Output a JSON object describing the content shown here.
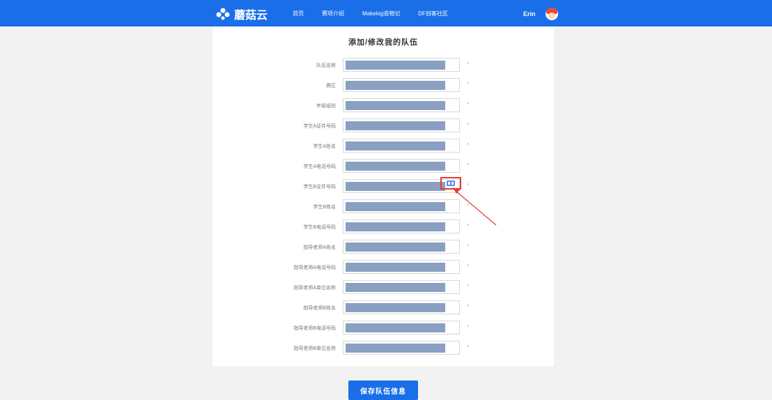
{
  "header": {
    "logo_text": "蘑菇云",
    "nav": [
      "首页",
      "赛项介绍",
      "Makelog造物记",
      "DF创客社区"
    ],
    "username": "Erin"
  },
  "form": {
    "title": "添加/修改我的队伍",
    "required_mark": "*",
    "fields": [
      {
        "label": "队伍名称"
      },
      {
        "label": "赛区"
      },
      {
        "label": "年级组别"
      },
      {
        "label": "学生A证件号码"
      },
      {
        "label": "学生A姓名"
      },
      {
        "label": "学生A电话号码"
      },
      {
        "label": "学生B证件号码"
      },
      {
        "label": "学生B姓名"
      },
      {
        "label": "学生B电话号码"
      },
      {
        "label": "指导老师A姓名"
      },
      {
        "label": "指导老师A电话号码"
      },
      {
        "label": "指导老师A单位名称"
      },
      {
        "label": "指导老师B姓名"
      },
      {
        "label": "指导老师B电话号码"
      },
      {
        "label": "指导老师B单位名称"
      }
    ]
  },
  "save_button": "保存队伍信息",
  "colors": {
    "brand": "#1a6fe8",
    "annotation": "#e53935",
    "redacted": "#8aa0c3"
  },
  "annotation_icon": "id-card-icon"
}
